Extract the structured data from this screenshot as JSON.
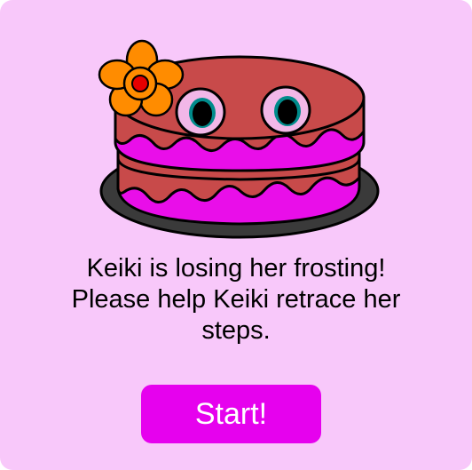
{
  "intro": {
    "mascot": {
      "name": "Keiki",
      "illustration": "cake-character",
      "frosting_color": "#e90ee9",
      "cake_color": "#c84a4a",
      "flower_color": "#ff8c00"
    },
    "message_lines": [
      "Keiki is losing her frosting!",
      "Please help Keiki retrace her",
      "steps."
    ],
    "start_label": "Start!",
    "colors": {
      "background": "#f8c8fa",
      "button": "#e601ee",
      "button_text": "#ffffff"
    }
  }
}
